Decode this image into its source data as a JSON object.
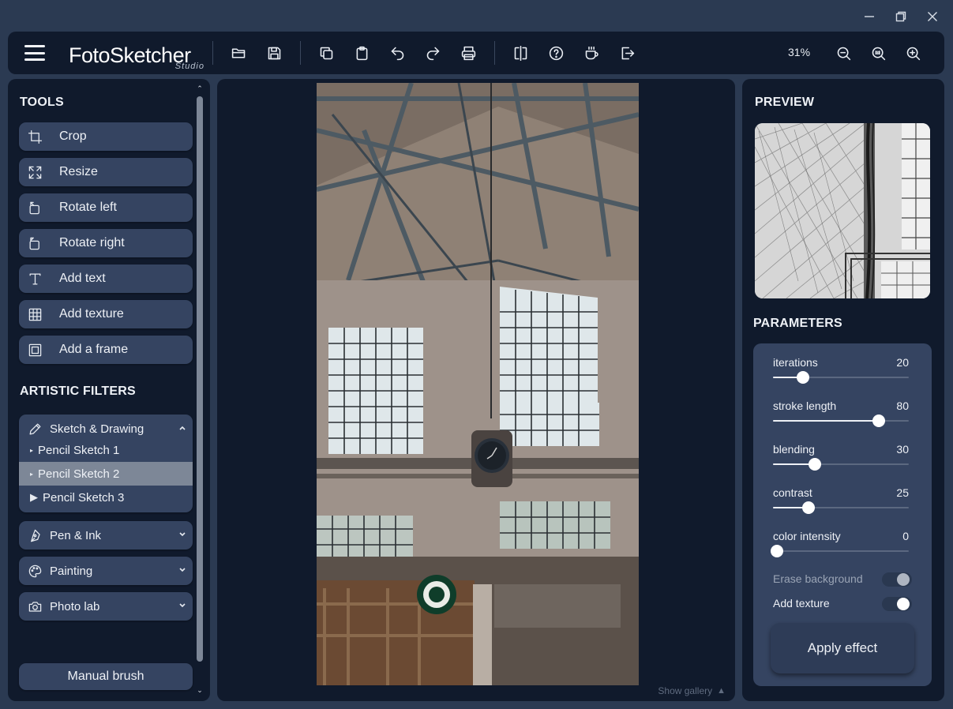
{
  "window": {
    "controls": [
      "minimize",
      "restore",
      "close"
    ]
  },
  "toolbar": {
    "logo_main": "FotoSketcher",
    "logo_sub": "Studio",
    "zoom_level": "31%",
    "icons": [
      "menu-icon",
      "open-folder-icon",
      "save-icon",
      "copy-icon",
      "paste-icon",
      "undo-icon",
      "redo-icon",
      "print-icon",
      "compare-icon",
      "help-icon",
      "coffee-icon",
      "exit-icon",
      "zoom-out-icon",
      "zoom-fit-icon",
      "zoom-in-icon"
    ]
  },
  "left_panel": {
    "tools_title": "TOOLS",
    "tools": [
      {
        "label": "Crop",
        "icon": "crop-icon"
      },
      {
        "label": "Resize",
        "icon": "resize-icon"
      },
      {
        "label": "Rotate left",
        "icon": "rotate-left-icon"
      },
      {
        "label": "Rotate right",
        "icon": "rotate-right-icon"
      },
      {
        "label": "Add text",
        "icon": "text-icon"
      },
      {
        "label": "Add texture",
        "icon": "texture-grid-icon"
      },
      {
        "label": "Add a frame",
        "icon": "frame-icon"
      }
    ],
    "filters_title": "ARTISTIC FILTERS",
    "filter_groups": [
      {
        "label": "Sketch & Drawing",
        "icon": "pencil-icon",
        "expanded": true,
        "items": [
          {
            "label": "Pencil Sketch 1"
          },
          {
            "label": "Pencil Sketch 2",
            "selected": true
          },
          {
            "label": "Pencil Sketch 3"
          }
        ]
      },
      {
        "label": "Pen & Ink",
        "icon": "pen-nib-icon",
        "expanded": false
      },
      {
        "label": "Painting",
        "icon": "palette-icon",
        "expanded": false
      },
      {
        "label": "Photo lab",
        "icon": "camera-icon",
        "expanded": false
      }
    ],
    "manual_brush_label": "Manual brush"
  },
  "canvas": {
    "gallery_toggle_label": "Show gallery"
  },
  "right_panel": {
    "preview_title": "PREVIEW",
    "params_title": "PARAMETERS",
    "params": [
      {
        "name": "iterations",
        "value": 20,
        "fraction": 0.22
      },
      {
        "name": "stroke length",
        "value": 80,
        "fraction": 0.78
      },
      {
        "name": "blending",
        "value": 30,
        "fraction": 0.31
      },
      {
        "name": "contrast",
        "value": 25,
        "fraction": 0.26
      },
      {
        "name": "color intensity",
        "value": 0,
        "fraction": 0.03
      }
    ],
    "toggles": [
      {
        "name": "Erase background",
        "on": false,
        "disabled": true
      },
      {
        "name": "Add texture",
        "on": true,
        "disabled": false
      }
    ],
    "apply_label": "Apply effect"
  }
}
